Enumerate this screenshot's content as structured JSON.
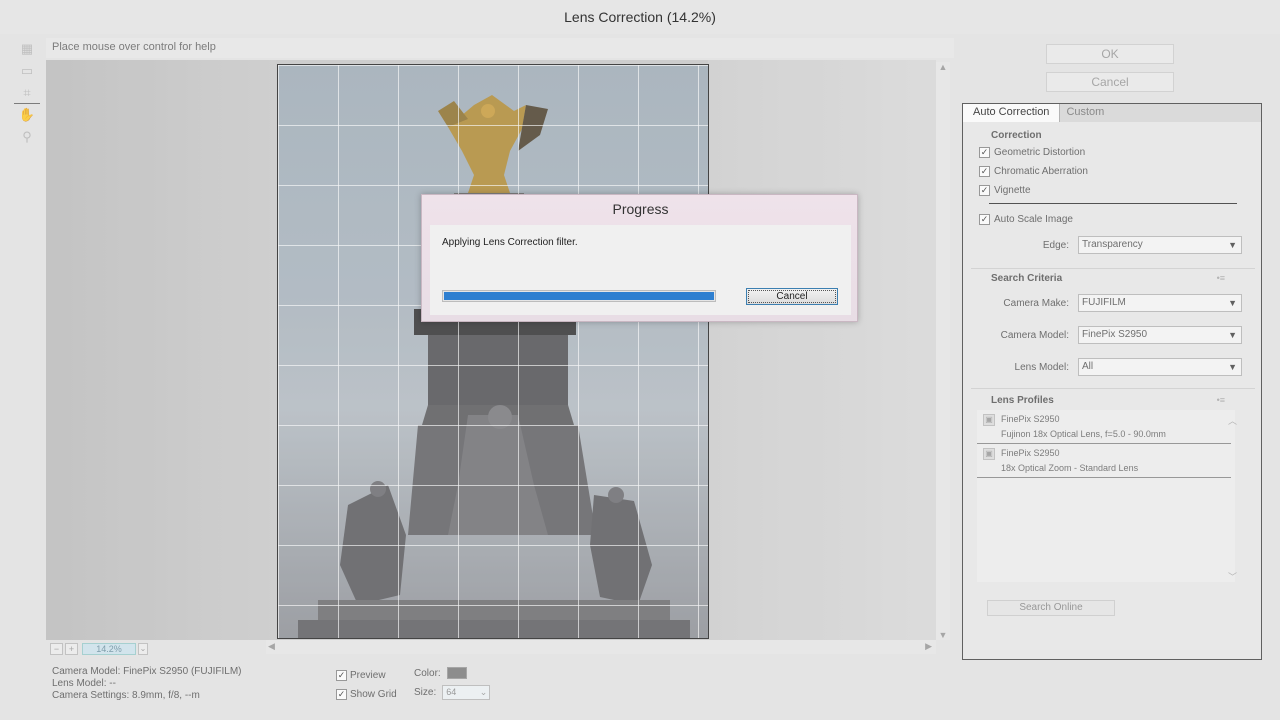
{
  "window": {
    "title": "Lens Correction (14.2%)"
  },
  "help_text": "Place mouse over control for help",
  "buttons": {
    "ok": "OK",
    "cancel": "Cancel"
  },
  "zoom": {
    "minus": "−",
    "plus": "+",
    "value": "14.2%",
    "dropdown": "⌄"
  },
  "camera_info": {
    "model": "Camera Model: FinePix S2950 (FUJIFILM)",
    "lens": "Lens Model: --",
    "settings": "Camera Settings: 8.9mm, f/8, --m"
  },
  "view_options": {
    "preview_label": "Preview",
    "preview_checked": true,
    "show_grid_label": "Show Grid",
    "show_grid_checked": true,
    "color_label": "Color:",
    "grid_color": "#7a7a7a",
    "size_label": "Size:",
    "size_value": "64"
  },
  "panel": {
    "tabs": [
      "Auto Correction",
      "Custom"
    ],
    "correction": {
      "title": "Correction",
      "items": [
        {
          "label": "Geometric Distortion",
          "checked": true
        },
        {
          "label": "Chromatic Aberration",
          "checked": true
        },
        {
          "label": "Vignette",
          "checked": true
        }
      ],
      "auto_scale": {
        "label": "Auto Scale Image",
        "checked": true
      },
      "edge_label": "Edge:",
      "edge_value": "Transparency"
    },
    "search_criteria": {
      "title": "Search Criteria",
      "camera_make_label": "Camera Make:",
      "camera_make_value": "FUJIFILM",
      "camera_model_label": "Camera Model:",
      "camera_model_value": "FinePix S2950",
      "lens_model_label": "Lens Model:",
      "lens_model_value": "All"
    },
    "lens_profiles": {
      "title": "Lens Profiles",
      "items": [
        {
          "name": "FinePix S2950",
          "lens": "Fujinon 18x Optical Lens, f=5.0 - 90.0mm"
        },
        {
          "name": "FinePix S2950",
          "lens": "18x Optical Zoom - Standard Lens"
        }
      ],
      "search_online": "Search Online"
    }
  },
  "progress_dialog": {
    "title": "Progress",
    "message": "Applying Lens Correction filter.",
    "progress": 1.0,
    "cancel": "Cancel"
  },
  "colors": {
    "progress_fill": "#2e7fd0",
    "dialog_title_bg": "#efe2ea"
  }
}
